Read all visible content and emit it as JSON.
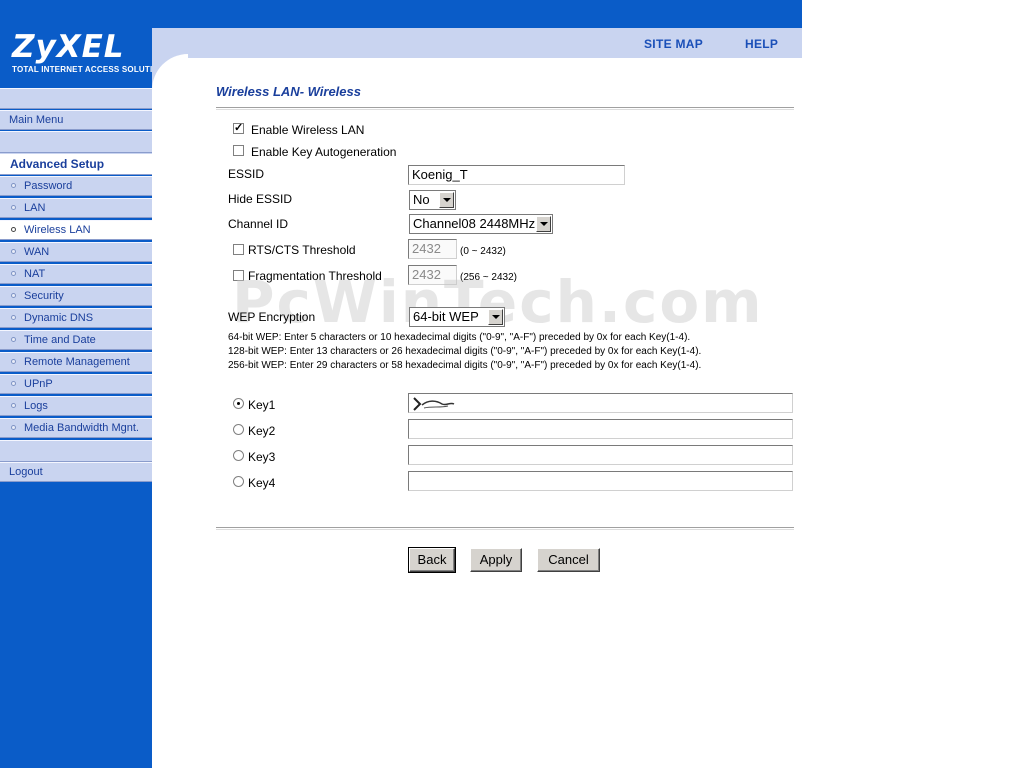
{
  "brand": {
    "logo": "ZyXEL",
    "tagline": "Total Internet Access Solution"
  },
  "top_links": {
    "site_map": "SITE MAP",
    "help": "HELP"
  },
  "sidebar": {
    "main_menu": "Main Menu",
    "section_header": "Advanced Setup",
    "items": [
      {
        "label": "Password"
      },
      {
        "label": "LAN"
      },
      {
        "label": "Wireless LAN"
      },
      {
        "label": "WAN"
      },
      {
        "label": "NAT"
      },
      {
        "label": "Security"
      },
      {
        "label": "Dynamic DNS"
      },
      {
        "label": "Time and Date"
      },
      {
        "label": "Remote Management"
      },
      {
        "label": "UPnP"
      },
      {
        "label": "Logs"
      },
      {
        "label": "Media Bandwidth Mgnt."
      }
    ],
    "active_item": "Wireless LAN",
    "logout": "Logout"
  },
  "page": {
    "title": "Wireless LAN- Wireless"
  },
  "form": {
    "enable_wireless": {
      "label": "Enable Wireless LAN",
      "checked": true
    },
    "key_autogen": {
      "label": "Enable Key Autogeneration",
      "checked": false
    },
    "essid": {
      "label": "ESSID",
      "value": "Koenig_T"
    },
    "hide_essid": {
      "label": "Hide ESSID",
      "value": "No"
    },
    "channel": {
      "label": "Channel ID",
      "value": "Channel08 2448MHz"
    },
    "rts": {
      "label": "RTS/CTS Threshold",
      "value": "2432",
      "range": "(0 ~ 2432)",
      "checked": false
    },
    "frag": {
      "label": "Fragmentation Threshold",
      "value": "2432",
      "range": "(256 ~ 2432)",
      "checked": false
    },
    "wep": {
      "label": "WEP Encryption",
      "value": "64-bit WEP"
    },
    "notes": [
      "64-bit WEP: Enter 5 characters or 10 hexadecimal digits (\"0-9\", \"A-F\") preceded by 0x for each Key(1-4).",
      "128-bit WEP: Enter 13 characters or 26 hexadecimal digits (\"0-9\", \"A-F\") preceded by 0x for each Key(1-4).",
      "256-bit WEP: Enter 29 characters or 58 hexadecimal digits (\"0-9\", \"A-F\") preceded by 0x for each Key(1-4)."
    ],
    "keys": [
      {
        "label": "Key1",
        "selected": true,
        "value": ""
      },
      {
        "label": "Key2",
        "selected": false,
        "value": ""
      },
      {
        "label": "Key3",
        "selected": false,
        "value": ""
      },
      {
        "label": "Key4",
        "selected": false,
        "value": ""
      }
    ]
  },
  "buttons": {
    "back": "Back",
    "apply": "Apply",
    "cancel": "Cancel"
  },
  "watermark": "PcWinTech.com",
  "colors": {
    "sidebar_blue": "#0a5cc8",
    "nav_light": "#c9d4f0",
    "title_blue": "#1a3f9c"
  }
}
